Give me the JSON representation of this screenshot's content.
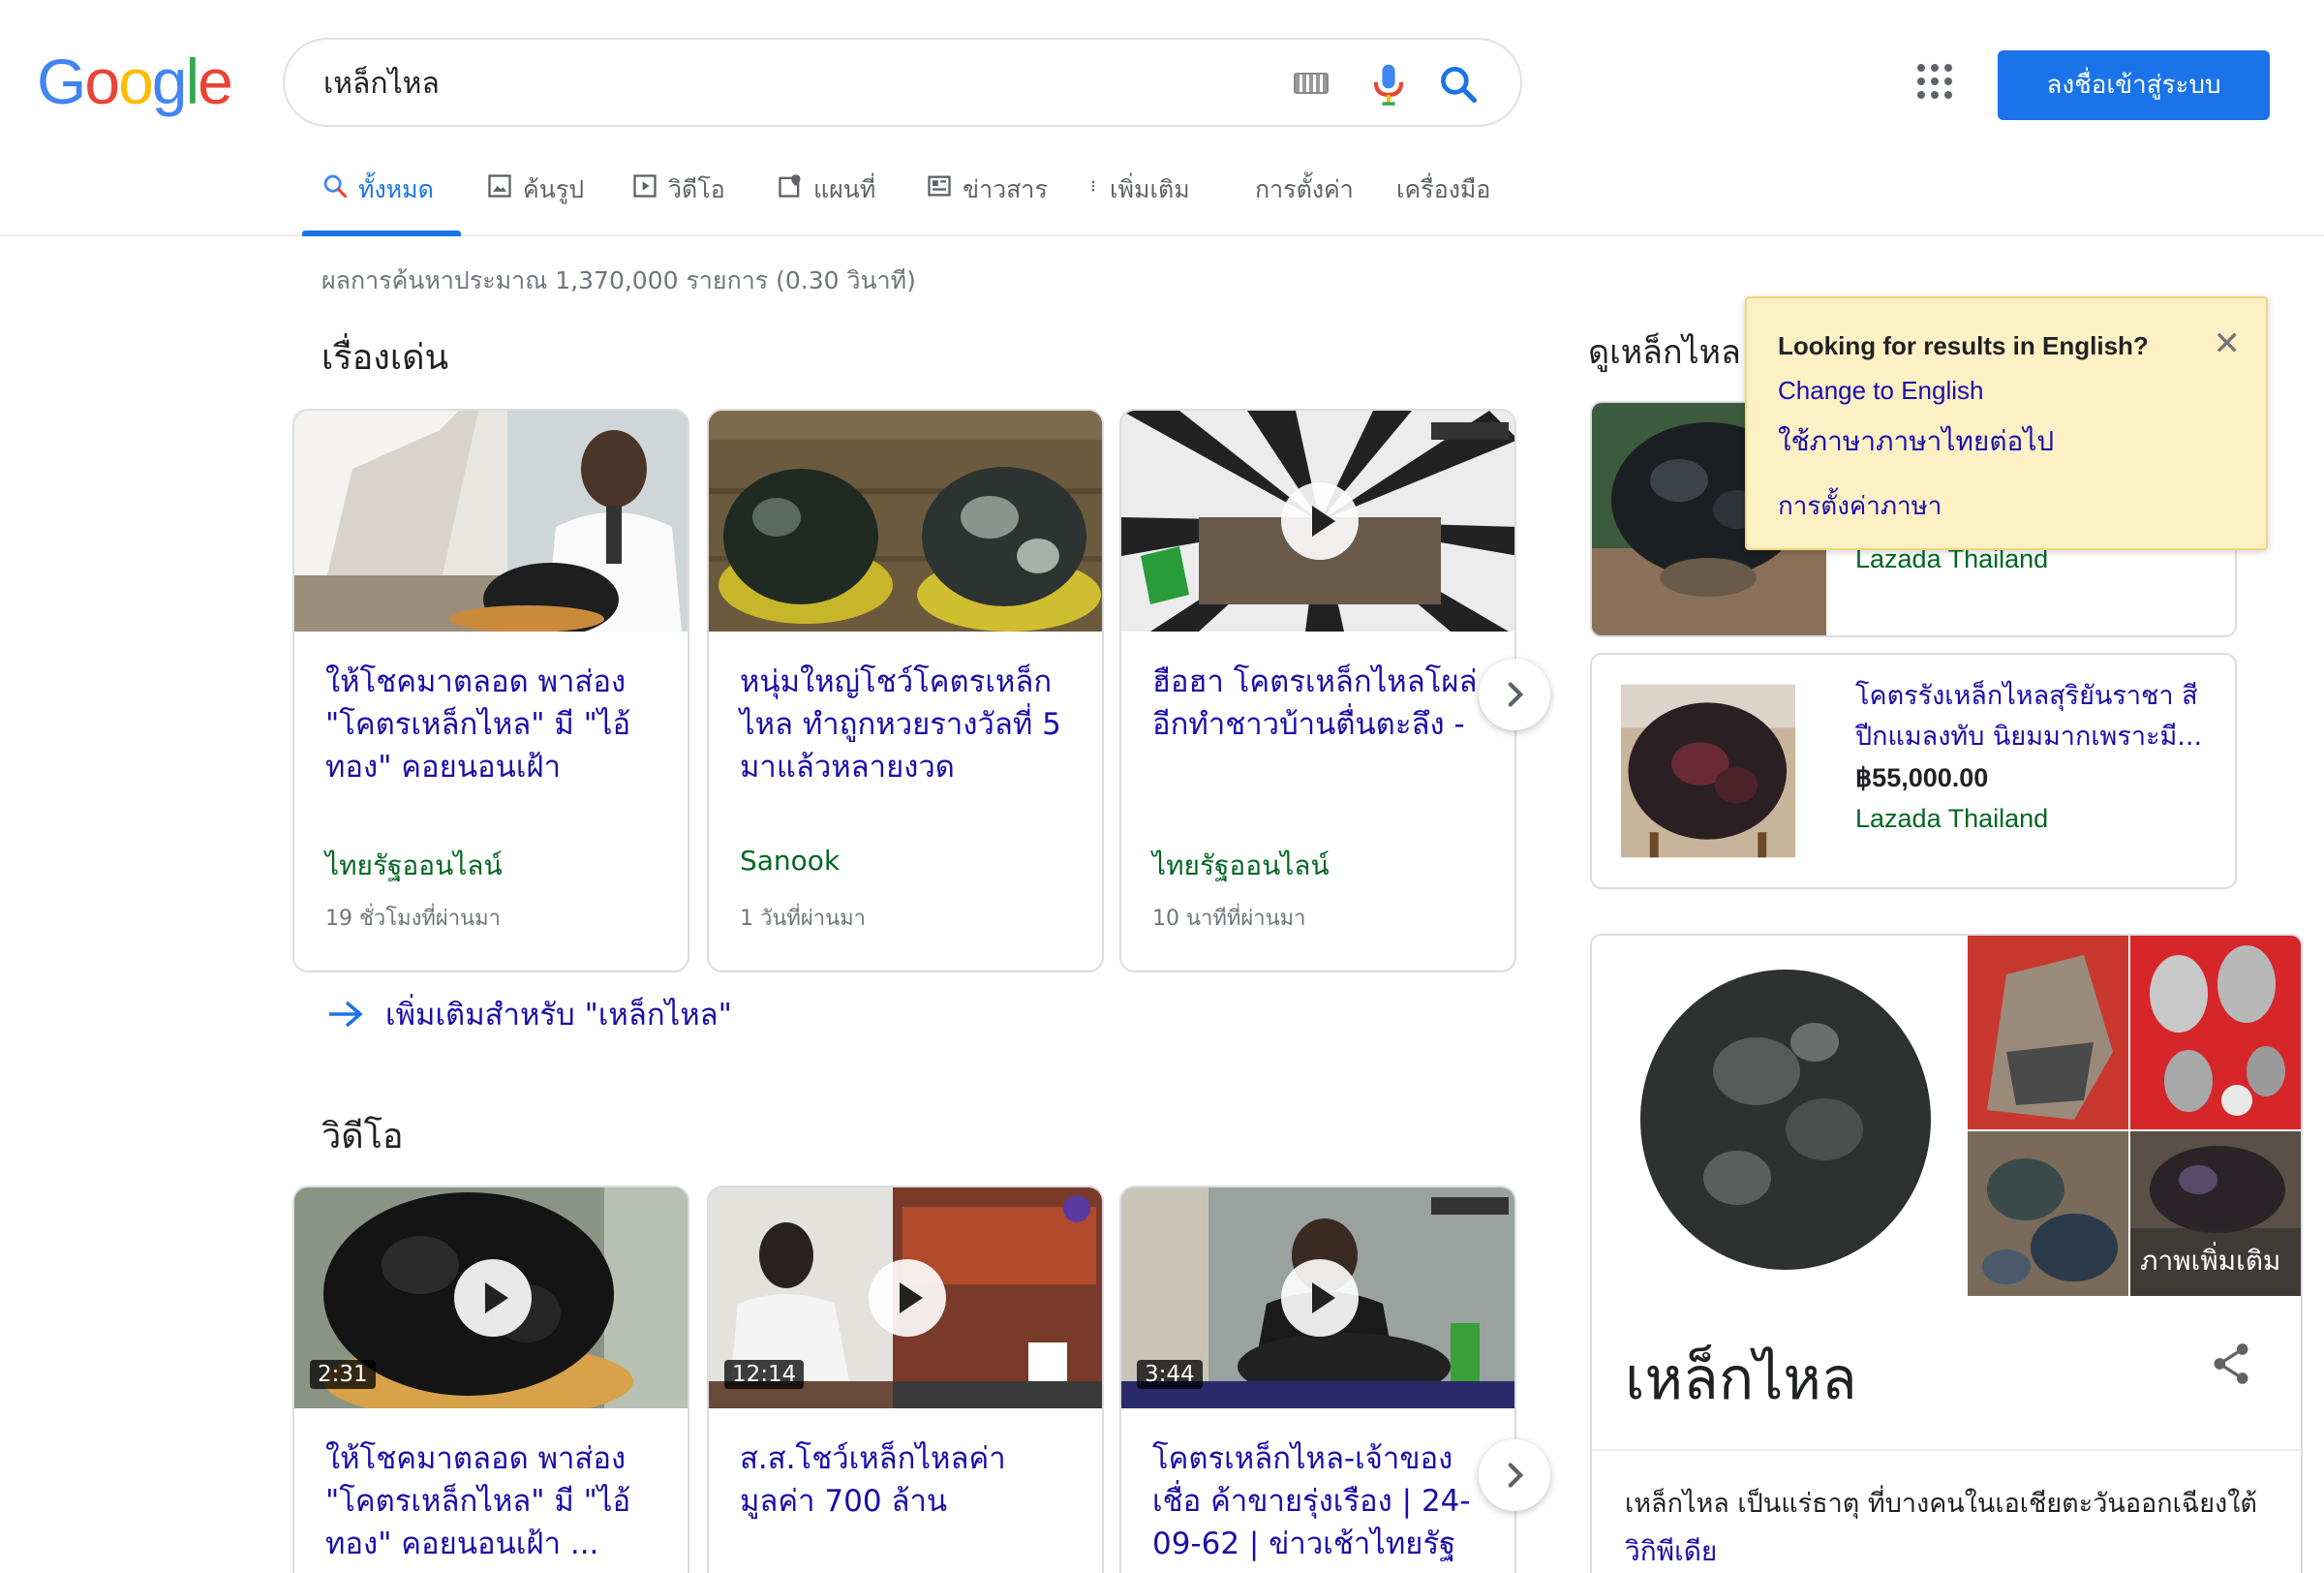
{
  "logo": {
    "text": "Google"
  },
  "search": {
    "query": "เหล็กไหล"
  },
  "header": {
    "signin_label": "ลงชื่อเข้าสู่ระบบ"
  },
  "tabs": [
    {
      "label": "ทั้งหมด",
      "icon": "search-icon"
    },
    {
      "label": "ค้นรูป",
      "icon": "image-icon"
    },
    {
      "label": "วิดีโอ",
      "icon": "video-icon"
    },
    {
      "label": "แผนที่",
      "icon": "map-icon"
    },
    {
      "label": "ข่าวสาร",
      "icon": "news-icon"
    },
    {
      "label": "เพิ่มเติม",
      "icon": "more-vert-icon"
    }
  ],
  "tools": {
    "settings_label": "การตั้งค่า",
    "tools_label": "เครื่องมือ"
  },
  "result_stats": "ผลการค้นหาประมาณ 1,370,000 รายการ (0.30 วินาที)",
  "top_stories": {
    "heading": "เรื่องเด่น",
    "cards": [
      {
        "title": "ให้โชคมาตลอด พาส่อง \"โคตรเหล็กไหล\" มี \"ไอ้ทอง\" คอยนอนเฝ้า",
        "source": "ไทยรัฐออนไลน์",
        "time": "19 ชั่วโมงที่ผ่านมา"
      },
      {
        "title": "หนุ่มใหญ่โชว์โคตรเหล็กไหล ทำถูกหวยรางวัลที่ 5 มาแล้วหลายงวด",
        "source": "Sanook",
        "time": "1 วันที่ผ่านมา"
      },
      {
        "title": "ฮือฮา โคตรเหล็กไหลโผล่ อีกทำชาวบ้านตื่นตะลึง -",
        "source": "ไทยรัฐออนไลน์",
        "time": "10 นาทีที่ผ่านมา"
      }
    ],
    "more_label": "เพิ่มเติมสำหรับ \"เหล็กไหล\""
  },
  "videos": {
    "heading": "วิดีโอ",
    "cards": [
      {
        "title": "ให้โชคมาตลอด พาส่อง \"โคตรเหล็กไหล\" มี \"ไอ้ทอง\" คอยนอนเฝ้า ...",
        "duration": "2:31"
      },
      {
        "title": "ส.ส.โชว์เหล็กไหลค่ามูลค่า 700 ล้าน",
        "duration": "12:14"
      },
      {
        "title": "โคตรเหล็กไหล-เจ้าของเชื่อ ค้าขายรุ่งเรือง | 24-09-62 | ข่าวเช้าไทยรัฐ",
        "duration": "3:44"
      }
    ]
  },
  "shopping": {
    "heading": "ดูเหล็กไหล",
    "items": [
      {
        "store": "Lazada Thailand"
      },
      {
        "title": "โคตรรังเหล็กไหลสุริยันราชา สีปีกแมลงทับ นิยมมากเพราะมี...",
        "price": "฿55,000.00",
        "store": "Lazada Thailand"
      }
    ]
  },
  "language_tooltip": {
    "question": "Looking for results in English?",
    "change_link": "Change to English",
    "keep_link": "ใช้ภาษาภาษาไทยต่อไป",
    "settings_link": "การตั้งค่าภาษา"
  },
  "knowledge_panel": {
    "more_images_label": "ภาพเพิ่มเติม",
    "title": "เหล็กไหล",
    "description": "เหล็กไหล เป็นแร่ธาตุ ที่บางคนในเอเชียตะวันออกเฉียงใต้",
    "source_link": "วิกิพีเดีย"
  },
  "colors": {
    "accent": "#1a73e8",
    "link": "#1a0dab",
    "source_green": "#006621",
    "tooltip_bg": "#fdf0c4"
  }
}
